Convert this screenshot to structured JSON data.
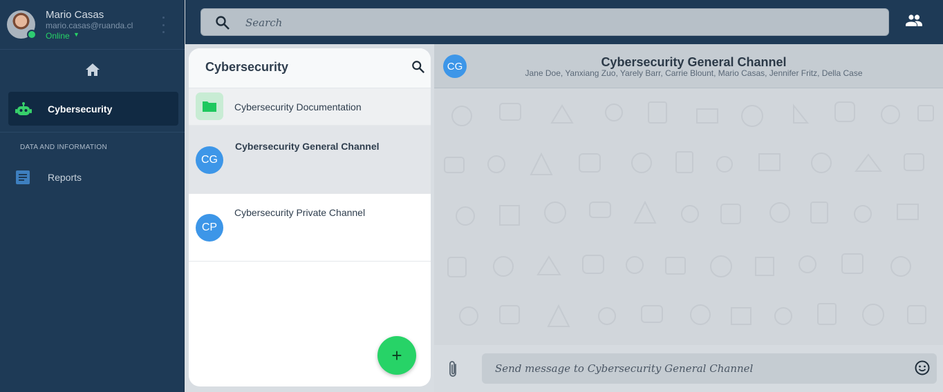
{
  "profile": {
    "name": "Mario Casas",
    "email": "mario.casas@ruanda.cl",
    "status": "Online"
  },
  "sidebar": {
    "home_icon": "home-icon",
    "selected": {
      "label": "Cybersecurity",
      "icon": "robot-icon"
    },
    "section_title": "DATA AND INFORMATION",
    "items": [
      {
        "label": "Reports",
        "icon": "document-icon"
      }
    ]
  },
  "search": {
    "placeholder": "Search"
  },
  "channels": {
    "title": "Cybersecurity",
    "items": [
      {
        "title": "Cybersecurity Documentation",
        "type": "folder"
      },
      {
        "title": "Cybersecurity General Channel",
        "initials": "CG",
        "selected": true
      },
      {
        "title": "Cybersecurity Private Channel",
        "initials": "CP"
      }
    ]
  },
  "chat": {
    "initials": "CG",
    "title": "Cybersecurity General Channel",
    "members": "Jane Doe, Yanxiang Zuo, Yarely Barr, Carrie Blount, Mario Casas, Jennifer Fritz, Della Case",
    "composer_placeholder": "Send message to Cybersecurity General Channel"
  },
  "colors": {
    "sidebar": "#1e3a56",
    "accent_green": "#27d367",
    "avatar_blue": "#3d96e8"
  }
}
